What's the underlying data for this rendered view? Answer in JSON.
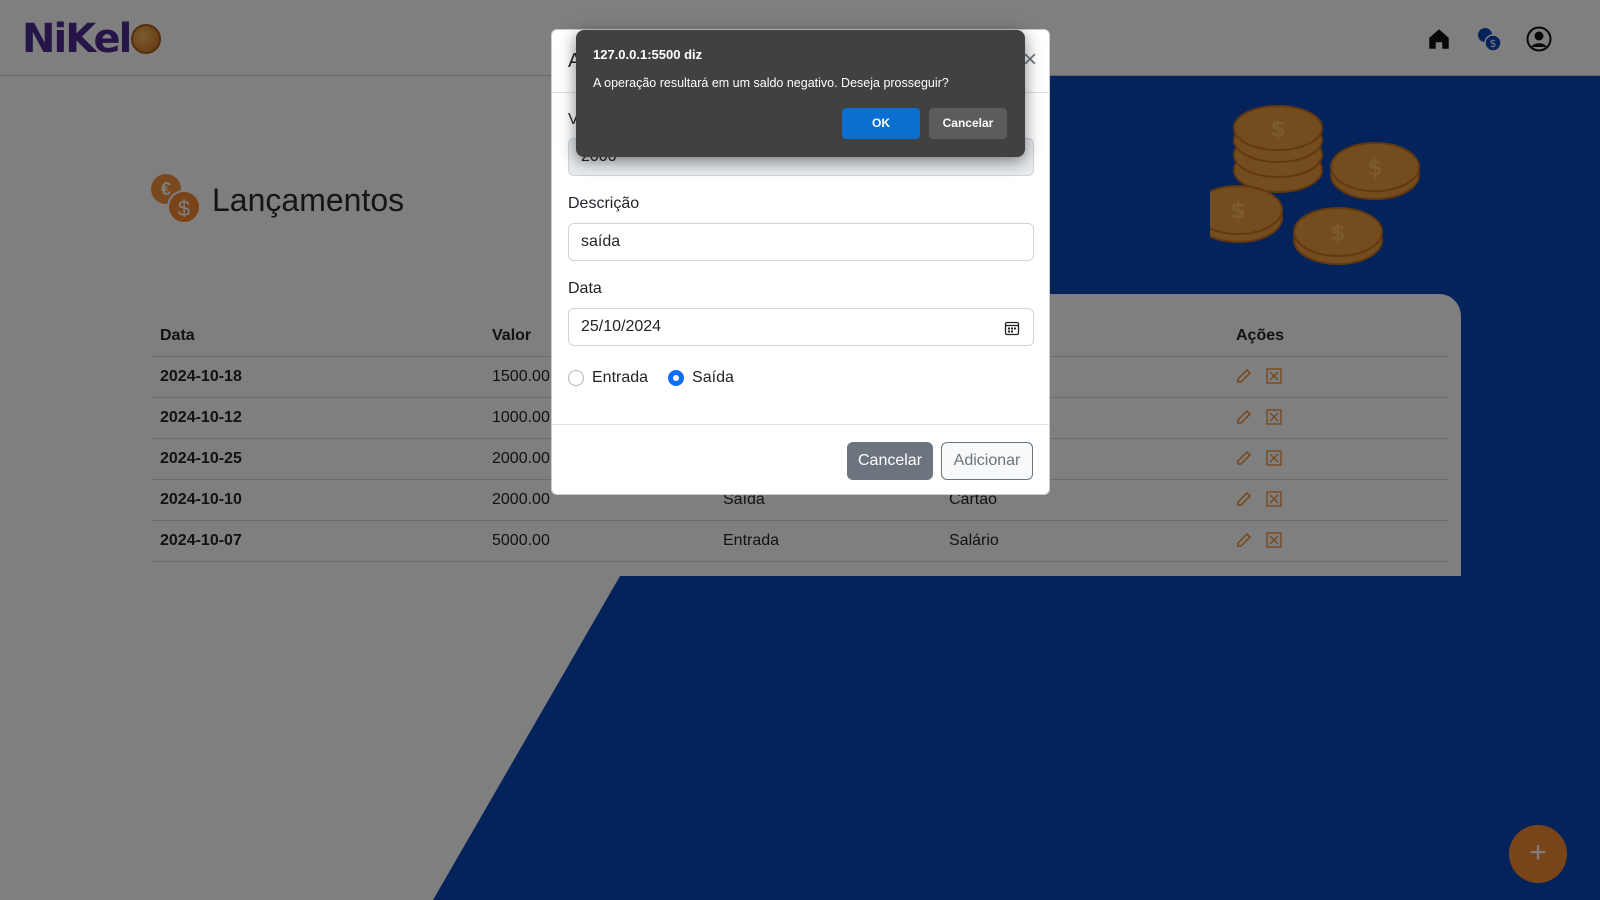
{
  "header": {
    "logo_text": "NiKel",
    "nav_icons": [
      "home-icon",
      "money-icon",
      "user-icon"
    ]
  },
  "page": {
    "title": "Lançamentos"
  },
  "table": {
    "headers": [
      "Data",
      "Valor",
      "",
      "",
      "Ações"
    ],
    "rows": [
      {
        "date": "2024-10-18",
        "value": "1500.00",
        "type": "",
        "description": ""
      },
      {
        "date": "2024-10-12",
        "value": "1000.00",
        "type": "",
        "description": ""
      },
      {
        "date": "2024-10-25",
        "value": "2000.00",
        "type": "",
        "description": ""
      },
      {
        "date": "2024-10-10",
        "value": "2000.00",
        "type": "Saída",
        "description": "Cartão"
      },
      {
        "date": "2024-10-07",
        "value": "5000.00",
        "type": "Entrada",
        "description": "Salário"
      }
    ]
  },
  "modal": {
    "title": "A",
    "close_label": "×",
    "value_label": "V",
    "value": "2000",
    "description_label": "Descrição",
    "description_value": "saída",
    "date_label": "Data",
    "date_value": "25/10/2024",
    "radio_entrada": "Entrada",
    "radio_saida": "Saída",
    "selected": "Saída",
    "cancel_label": "Cancelar",
    "add_label": "Adicionar"
  },
  "dialog": {
    "origin": "127.0.0.1:5500 diz",
    "message": "A operação resultará em um saldo negativo. Deseja prosseguir?",
    "ok_label": "OK",
    "cancel_label": "Cancelar"
  },
  "fab": {
    "label": "+"
  },
  "colors": {
    "brand_blue": "#0a47b7",
    "accent_orange": "#f28b30",
    "primary": "#0d6efd"
  }
}
